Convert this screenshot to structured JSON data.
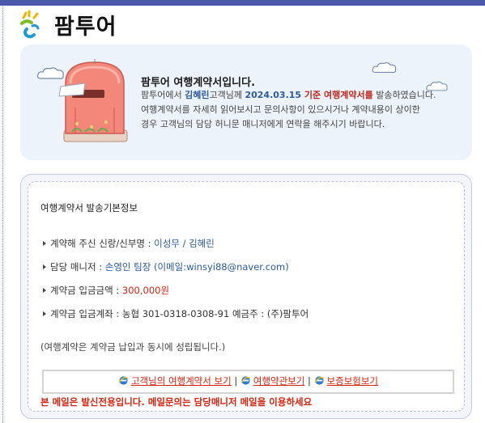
{
  "brand": {
    "name": "팜투어"
  },
  "intro": {
    "title": "팜투어 여행계약서입니다.",
    "line1_prefix": "팜투어에서 ",
    "customer": "김혜린",
    "line1_mid": "고객님께 ",
    "date": "2024.03.15",
    "line1_base": " 기준 ",
    "doc_name": "여행계약서를",
    "line1_suffix": " 발송하였습니다.",
    "line2": "여행계약서를 자세히 읽어보시고 문의사항이 있으시거나 계약내용이 상이한",
    "line3": "경우 고객님의 담당 허니문 매니저에게 연락을 해주시기 바랍니다."
  },
  "info": {
    "title": "여행계약서 발송기본정보",
    "rows": [
      {
        "label": "계약해 주신 신랑/신부명 : ",
        "value": "이성무 / 김혜린",
        "extra": ""
      },
      {
        "label": "담당 매니저 : ",
        "value": "손영인 팀장",
        "extra": " (이메일:winsyi88@naver.com)"
      },
      {
        "label": "계약금 입금금액 : ",
        "value": "300,000원",
        "extra": ""
      },
      {
        "label": "계약금 입금계좌 : ",
        "value": "농협 301-0318-0308-91 예금주 : (주)팜투어",
        "extra": ""
      }
    ],
    "note": "(여행계약은 계약금 납입과 동시에 성립됩니다.)"
  },
  "links": [
    {
      "label": "고객님의 여행계약서 보기"
    },
    {
      "label": "여행약관보기"
    },
    {
      "label": "보증보험보기"
    }
  ],
  "link_separator": "|",
  "warning": "본 메일은 발신전용입니다. 메일문의는 담당매니저 메일을 이용하세요",
  "colors": {
    "accent_blue": "#2c5aa0",
    "accent_red": "#d9230f",
    "top_bar": "#4a5aa8",
    "intro_bg": "#edf3fa"
  }
}
